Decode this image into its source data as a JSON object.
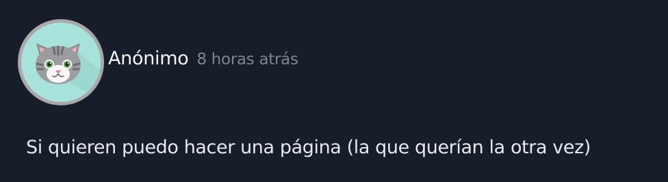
{
  "comment": {
    "avatar_icon": "cat-face-icon",
    "author": "Anónimo",
    "timestamp": "8 horas atrás",
    "text": "Si quieren puedo hacer una página (la que querían la otra vez)"
  },
  "colors": {
    "background": "#171e29",
    "avatar_ring": "#a9a9a9",
    "avatar_bg": "#a8e3db",
    "author_text": "#f4f6f8",
    "timestamp_text": "#7b8591",
    "body_text": "#e6e9ee"
  }
}
